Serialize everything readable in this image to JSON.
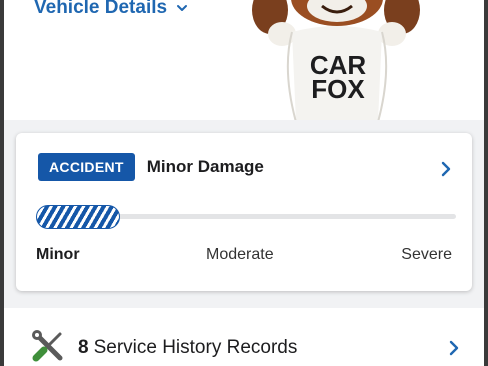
{
  "header": {
    "vehicle_details_label": "Vehicle Details",
    "mascot_text": "CAR FOX"
  },
  "accident_card": {
    "badge": "ACCIDENT",
    "title": "Minor Damage",
    "severity_level": "Minor",
    "severity_fill_fraction": 0.2,
    "severity_scale": [
      "Minor",
      "Moderate",
      "Severe"
    ]
  },
  "service_history": {
    "count": "8",
    "label": "Service History Records"
  },
  "colors": {
    "brand_blue": "#1557a8",
    "link_blue": "#1f67b1",
    "wrench_green": "#3f8f3a"
  }
}
